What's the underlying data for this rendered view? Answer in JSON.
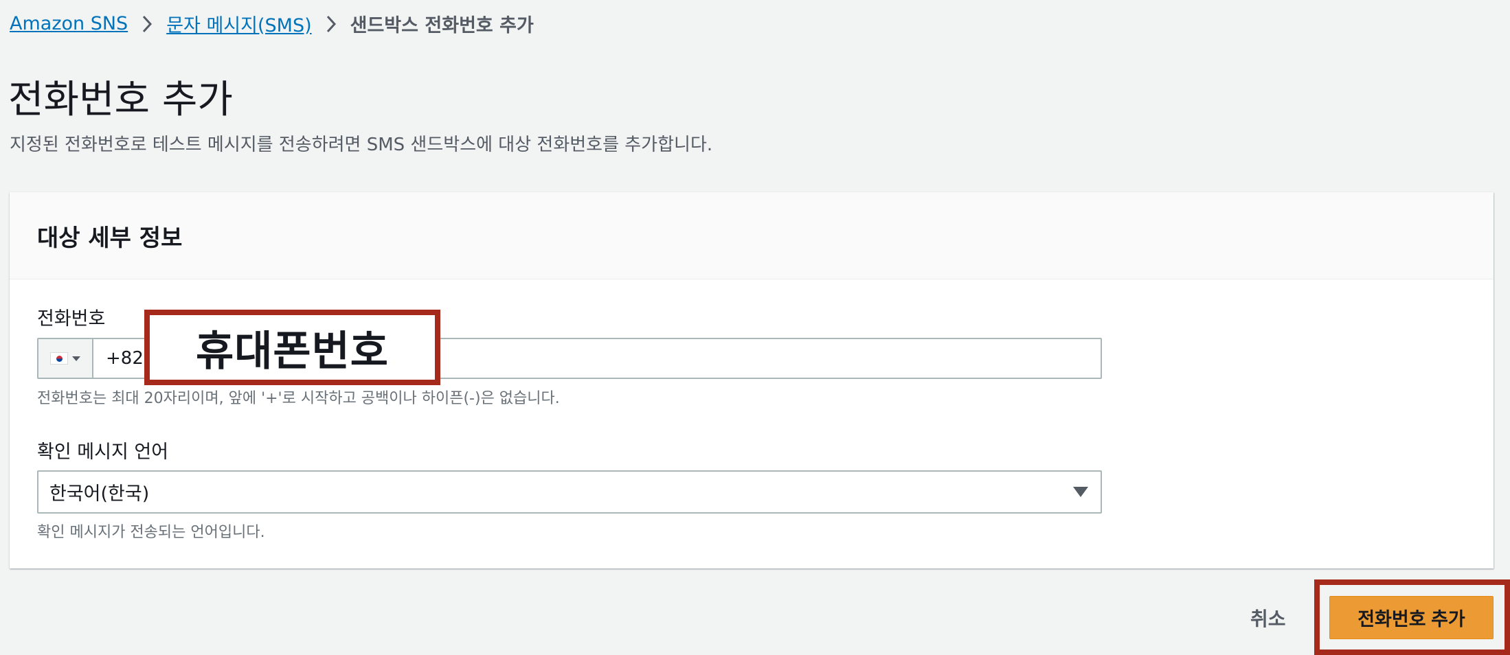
{
  "breadcrumb": {
    "items": [
      "Amazon SNS",
      "문자 메시지(SMS)"
    ],
    "current": "샌드박스 전화번호 추가"
  },
  "page": {
    "title": "전화번호 추가",
    "description": "지정된 전화번호로 테스트 메시지를 전송하려면 SMS 샌드박스에 대상 전화번호를 추가합니다."
  },
  "card": {
    "title": "대상 세부 정보",
    "phone": {
      "label": "전화번호",
      "country_icon": "south-korea-flag-icon",
      "prefix": "+82",
      "hint": "전화번호는 최대 20자리이며, 앞에 '+'로 시작하고 공백이나 하이픈(-)은 없습니다."
    },
    "language": {
      "label": "확인 메시지 언어",
      "selected": "한국어(한국)",
      "hint": "확인 메시지가 전송되는 언어입니다."
    }
  },
  "annotation": {
    "text": "휴대폰번호",
    "color": "#a52a1c"
  },
  "actions": {
    "cancel_label": "취소",
    "submit_label": "전화번호 추가",
    "submit_color": "#ec9b34"
  }
}
